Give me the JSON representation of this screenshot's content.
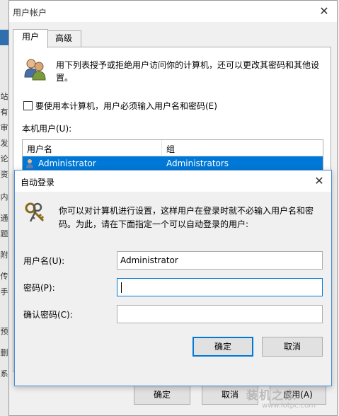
{
  "background": {
    "chars": [
      "",
      "",
      "站",
      "有",
      "审",
      "发",
      "论",
      "资",
      "",
      "内",
      "",
      "通",
      "题",
      "",
      "附",
      "",
      "传",
      "手",
      "",
      "预",
      "",
      "删",
      "",
      "系"
    ]
  },
  "window": {
    "title": "用户帐户",
    "close_glyph": "✕",
    "tabs": [
      {
        "label": "用户"
      },
      {
        "label": "高级"
      }
    ],
    "description": "用下列表授予或拒绝用户访问你的计算机，还可以更改其密码和其他设置。",
    "checkbox_label": "要使用本计算机，用户必须输入用户名和密码(E)",
    "local_users_label": "本机用户(U):",
    "list": {
      "columns": [
        "用户名",
        "组"
      ],
      "rows": [
        {
          "name": "Administrator",
          "group": "Administrators"
        }
      ]
    },
    "buttons": {
      "ok": "确定",
      "cancel": "取消",
      "apply": "应用(A)"
    }
  },
  "dialog": {
    "title": "自动登录",
    "close_glyph": "✕",
    "description": "你可以对计算机进行设置，这样用户在登录时就不必输入用户名和密码。为此，请在下面指定一个可以自动登录的用户:",
    "fields": {
      "username_label": "用户名(U):",
      "username_value": "Administrator",
      "password_label": "密码(P):",
      "password_value": "",
      "confirm_label": "确认密码(C):",
      "confirm_value": ""
    },
    "buttons": {
      "ok": "确定",
      "cancel": "取消"
    }
  },
  "watermark": {
    "text": "装机之家",
    "sub": "www.lotpc.com"
  },
  "colors": {
    "accent": "#0078d7",
    "selection": "#0078d7"
  },
  "icons": [
    "users-icon",
    "keys-icon",
    "user-icon",
    "close-icon"
  ]
}
